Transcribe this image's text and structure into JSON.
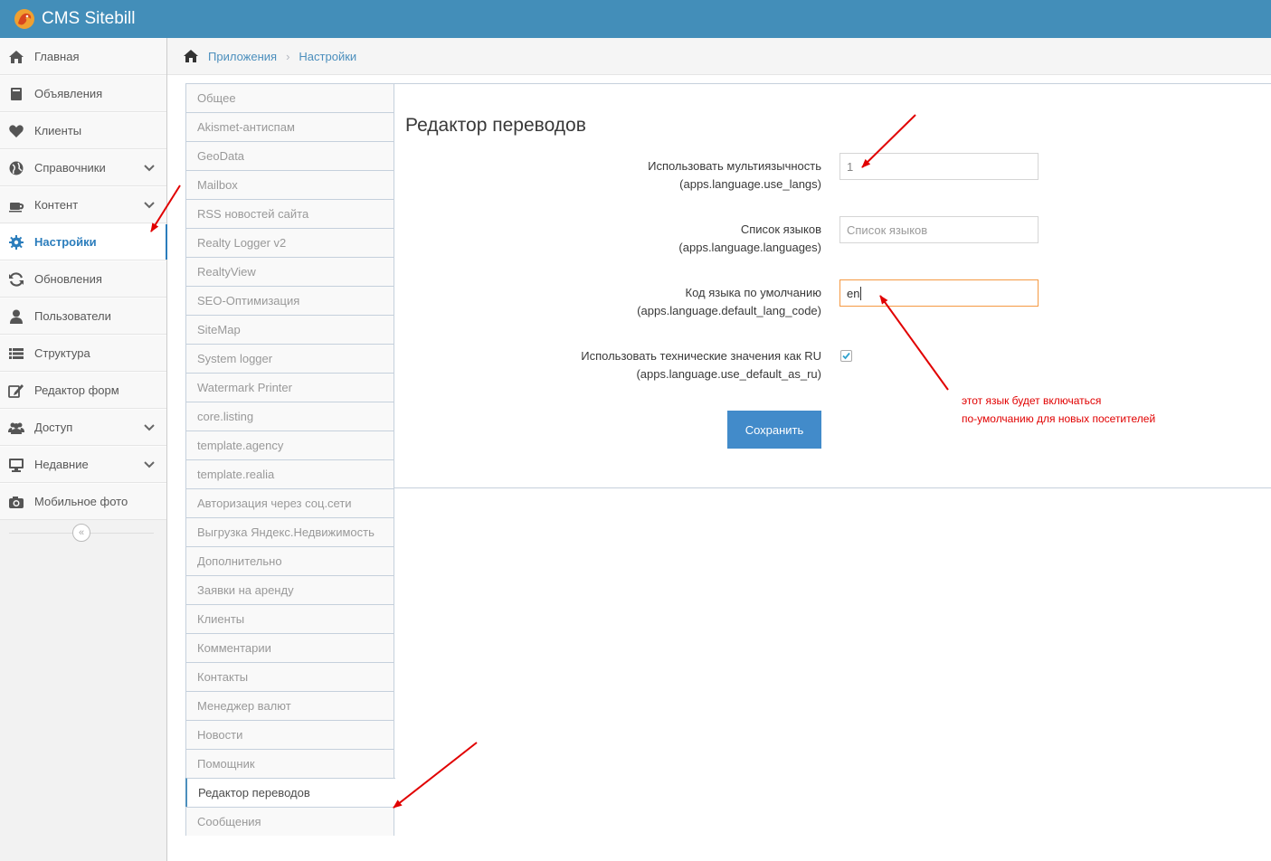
{
  "app": {
    "title": "CMS Sitebill"
  },
  "sidebar": {
    "items": [
      {
        "label": "Главная",
        "icon": "home-icon",
        "has_submenu": false
      },
      {
        "label": "Объявления",
        "icon": "book-icon",
        "has_submenu": false
      },
      {
        "label": "Клиенты",
        "icon": "heart-icon",
        "has_submenu": false
      },
      {
        "label": "Справочники",
        "icon": "globe-icon",
        "has_submenu": true
      },
      {
        "label": "Контент",
        "icon": "coffee-icon",
        "has_submenu": true
      },
      {
        "label": "Настройки",
        "icon": "gear-icon",
        "has_submenu": false,
        "active": true
      },
      {
        "label": "Обновления",
        "icon": "refresh-icon",
        "has_submenu": false
      },
      {
        "label": "Пользователи",
        "icon": "user-icon",
        "has_submenu": false
      },
      {
        "label": "Структура",
        "icon": "list-icon",
        "has_submenu": false
      },
      {
        "label": "Редактор форм",
        "icon": "edit-icon",
        "has_submenu": false
      },
      {
        "label": "Доступ",
        "icon": "users-icon",
        "has_submenu": true
      },
      {
        "label": "Недавние",
        "icon": "desktop-icon",
        "has_submenu": true
      },
      {
        "label": "Мобильное фото",
        "icon": "camera-icon",
        "has_submenu": false
      }
    ]
  },
  "breadcrumbs": {
    "items": [
      "Приложения",
      "Настройки"
    ]
  },
  "tabs": [
    "Общее",
    "Akismet-антиспам",
    "GeoData",
    "Mailbox",
    "RSS новостей сайта",
    "Realty Logger v2",
    "RealtyView",
    "SEO-Оптимизация",
    "SiteMap",
    "System logger",
    "Watermark Printer",
    "core.listing",
    "template.agency",
    "template.realia",
    "Авторизация через соц.сети",
    "Выгрузка Яндекс.Недвижимость",
    "Дополнительно",
    "Заявки на аренду",
    "Клиенты",
    "Комментарии",
    "Контакты",
    "Менеджер валют",
    "Новости",
    "Помощник",
    "Редактор переводов",
    "Сообщения"
  ],
  "active_tab": "Редактор переводов",
  "form": {
    "title": "Редактор переводов",
    "fields": {
      "use_langs": {
        "label": "Использовать мультиязычность",
        "key": "(apps.language.use_langs)",
        "value": "1"
      },
      "languages": {
        "label": "Список языков",
        "key": "(apps.language.languages)",
        "placeholder": "Список языков"
      },
      "default_lang": {
        "label": "Код языка по умолчанию",
        "key": "(apps.language.default_lang_code)",
        "value": "en"
      },
      "use_default_as_ru": {
        "label": "Использовать технические значения как RU",
        "key": "(apps.language.use_default_as_ru)",
        "checked": true
      }
    },
    "save_label": "Сохранить"
  },
  "annotation": {
    "line1": "этот язык будет включаться",
    "line2": "по-умолчанию для новых посетителей",
    "color": "#e10000"
  },
  "colors": {
    "navbar": "#438eb9",
    "accent": "#2b7dbc",
    "button": "#428bca"
  }
}
